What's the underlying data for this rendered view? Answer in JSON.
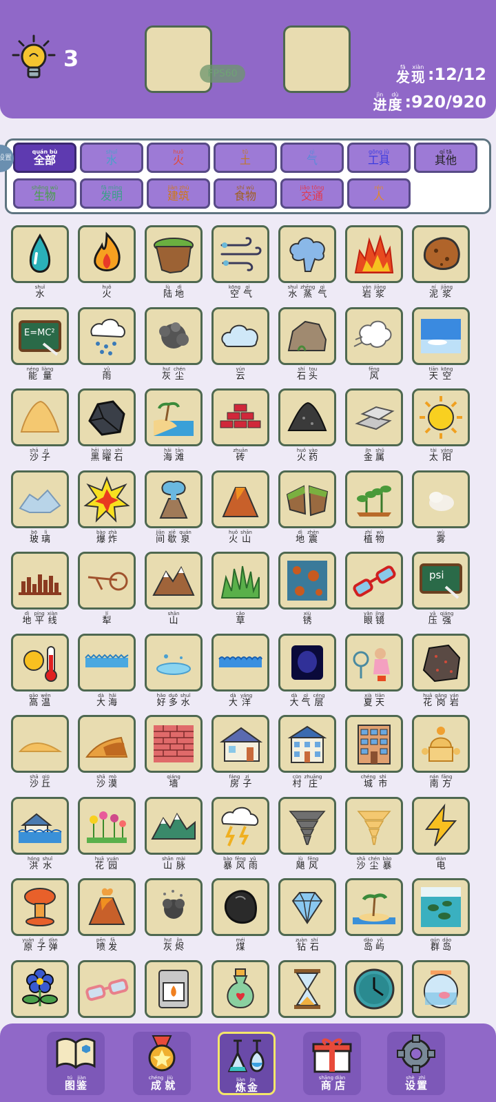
{
  "header": {
    "hint_count": "3",
    "fps": "FPS60",
    "discover": {
      "label": [
        {
          "py": "fā",
          "hz": "发"
        },
        {
          "py": "xiàn",
          "hz": "现"
        }
      ],
      "value": ":12/12"
    },
    "progress": {
      "label": [
        {
          "py": "jìn",
          "hz": "进"
        },
        {
          "py": "dù",
          "hz": "度"
        }
      ],
      "value": ":920/920"
    }
  },
  "side_tab": "设置",
  "categories": [
    {
      "py": "quán bù",
      "hz": "全部",
      "color": "#ffffff",
      "active": true
    },
    {
      "py": "shuǐ",
      "hz": "水",
      "color": "#4aa0c8"
    },
    {
      "py": "huǒ",
      "hz": "火",
      "color": "#e24a3a"
    },
    {
      "py": "tǔ",
      "hz": "土",
      "color": "#c07828"
    },
    {
      "py": "qì",
      "hz": "气",
      "color": "#5a8ad8"
    },
    {
      "py": "gōng jù",
      "hz": "工具",
      "color": "#3a3ae0"
    },
    {
      "py": "qí tā",
      "hz": "其他",
      "color": "#222222"
    },
    {
      "py": "shēng wù",
      "hz": "生物",
      "color": "#48a048"
    },
    {
      "py": "fā míng",
      "hz": "发明",
      "color": "#3aa088"
    },
    {
      "py": "jiàn zhù",
      "hz": "建筑",
      "color": "#d07818"
    },
    {
      "py": "shí wù",
      "hz": "食物",
      "color": "#a06020"
    },
    {
      "py": "jiāo tōng",
      "hz": "交通",
      "color": "#e03a50"
    },
    {
      "py": "rén",
      "hz": "人",
      "color": "#e0882a"
    }
  ],
  "elements": [
    {
      "icon": "water-drop",
      "name": [
        {
          "py": "shuǐ",
          "hz": "水"
        }
      ]
    },
    {
      "icon": "fire",
      "name": [
        {
          "py": "huǒ",
          "hz": "火"
        }
      ]
    },
    {
      "icon": "land",
      "name": [
        {
          "py": "lù",
          "hz": "陆"
        },
        {
          "py": "dì",
          "hz": "地"
        }
      ]
    },
    {
      "icon": "air",
      "name": [
        {
          "py": "kōng",
          "hz": "空"
        },
        {
          "py": "qì",
          "hz": "气"
        }
      ]
    },
    {
      "icon": "steam",
      "name": [
        {
          "py": "shuǐ",
          "hz": "水"
        },
        {
          "py": "zhēng",
          "hz": "蒸"
        },
        {
          "py": "qì",
          "hz": "气"
        }
      ]
    },
    {
      "icon": "lava",
      "name": [
        {
          "py": "yán",
          "hz": "岩"
        },
        {
          "py": "jiāng",
          "hz": "浆"
        }
      ]
    },
    {
      "icon": "mud",
      "name": [
        {
          "py": "ní",
          "hz": "泥"
        },
        {
          "py": "jiāng",
          "hz": "浆"
        }
      ]
    },
    {
      "icon": "energy",
      "name": [
        {
          "py": "néng",
          "hz": "能"
        },
        {
          "py": "liàng",
          "hz": "量"
        }
      ]
    },
    {
      "icon": "rain",
      "name": [
        {
          "py": "yǔ",
          "hz": "雨"
        }
      ]
    },
    {
      "icon": "dust",
      "name": [
        {
          "py": "huī",
          "hz": "灰"
        },
        {
          "py": "chén",
          "hz": "尘"
        }
      ]
    },
    {
      "icon": "cloud",
      "name": [
        {
          "py": "yún",
          "hz": "云"
        }
      ]
    },
    {
      "icon": "stone",
      "name": [
        {
          "py": "shí",
          "hz": "石"
        },
        {
          "py": "tou",
          "hz": "头"
        }
      ]
    },
    {
      "icon": "wind",
      "name": [
        {
          "py": "fēng",
          "hz": "风"
        }
      ]
    },
    {
      "icon": "sky",
      "name": [
        {
          "py": "tiān",
          "hz": "天"
        },
        {
          "py": "kōng",
          "hz": "空"
        }
      ]
    },
    {
      "icon": "sand",
      "name": [
        {
          "py": "shā",
          "hz": "沙"
        },
        {
          "py": "zi",
          "hz": "子"
        }
      ]
    },
    {
      "icon": "obsidian",
      "name": [
        {
          "py": "hēi",
          "hz": "黑"
        },
        {
          "py": "yào",
          "hz": "曜"
        },
        {
          "py": "shí",
          "hz": "石"
        }
      ]
    },
    {
      "icon": "beach",
      "name": [
        {
          "py": "hǎi",
          "hz": "海"
        },
        {
          "py": "tān",
          "hz": "滩"
        }
      ]
    },
    {
      "icon": "brick",
      "name": [
        {
          "py": "zhuān",
          "hz": "砖"
        }
      ]
    },
    {
      "icon": "gunpowder",
      "name": [
        {
          "py": "huǒ",
          "hz": "火"
        },
        {
          "py": "yào",
          "hz": "药"
        }
      ]
    },
    {
      "icon": "metal",
      "name": [
        {
          "py": "jīn",
          "hz": "金"
        },
        {
          "py": "shǔ",
          "hz": "属"
        }
      ]
    },
    {
      "icon": "sun",
      "name": [
        {
          "py": "tài",
          "hz": "太"
        },
        {
          "py": "yáng",
          "hz": "阳"
        }
      ]
    },
    {
      "icon": "glass",
      "name": [
        {
          "py": "bō",
          "hz": "玻"
        },
        {
          "py": "li",
          "hz": "璃"
        }
      ]
    },
    {
      "icon": "explosion",
      "name": [
        {
          "py": "bào",
          "hz": "爆"
        },
        {
          "py": "zhà",
          "hz": "炸"
        }
      ]
    },
    {
      "icon": "geyser",
      "name": [
        {
          "py": "jiān",
          "hz": "间"
        },
        {
          "py": "xiē",
          "hz": "歇"
        },
        {
          "py": "quán",
          "hz": "泉"
        }
      ]
    },
    {
      "icon": "volcano",
      "name": [
        {
          "py": "huǒ",
          "hz": "火"
        },
        {
          "py": "shān",
          "hz": "山"
        }
      ]
    },
    {
      "icon": "earthquake",
      "name": [
        {
          "py": "dì",
          "hz": "地"
        },
        {
          "py": "zhèn",
          "hz": "震"
        }
      ]
    },
    {
      "icon": "plant",
      "name": [
        {
          "py": "zhí",
          "hz": "植"
        },
        {
          "py": "wù",
          "hz": "物"
        }
      ]
    },
    {
      "icon": "fog",
      "name": [
        {
          "py": "wù",
          "hz": "雾"
        }
      ]
    },
    {
      "icon": "horizon",
      "name": [
        {
          "py": "dì",
          "hz": "地"
        },
        {
          "py": "píng",
          "hz": "平"
        },
        {
          "py": "xiàn",
          "hz": "线"
        }
      ]
    },
    {
      "icon": "plow",
      "name": [
        {
          "py": "lí",
          "hz": "犁"
        }
      ]
    },
    {
      "icon": "mountain",
      "name": [
        {
          "py": "shān",
          "hz": "山"
        }
      ]
    },
    {
      "icon": "grass",
      "name": [
        {
          "py": "cǎo",
          "hz": "草"
        }
      ]
    },
    {
      "icon": "rust",
      "name": [
        {
          "py": "xiù",
          "hz": "锈"
        }
      ]
    },
    {
      "icon": "glasses",
      "name": [
        {
          "py": "yǎn",
          "hz": "眼"
        },
        {
          "py": "jìng",
          "hz": "镜"
        }
      ]
    },
    {
      "icon": "pressure",
      "name": [
        {
          "py": "yā",
          "hz": "压"
        },
        {
          "py": "qiáng",
          "hz": "强"
        }
      ]
    },
    {
      "icon": "heat",
      "name": [
        {
          "py": "gāo",
          "hz": "高"
        },
        {
          "py": "wēn",
          "hz": "温"
        }
      ]
    },
    {
      "icon": "sea",
      "name": [
        {
          "py": "dà",
          "hz": "大"
        },
        {
          "py": "hǎi",
          "hz": "海"
        }
      ]
    },
    {
      "icon": "puddle",
      "name": [
        {
          "py": "hǎo",
          "hz": "好"
        },
        {
          "py": "duō",
          "hz": "多"
        },
        {
          "py": "shuǐ",
          "hz": "水"
        }
      ]
    },
    {
      "icon": "ocean",
      "name": [
        {
          "py": "dà",
          "hz": "大"
        },
        {
          "py": "yáng",
          "hz": "洋"
        }
      ]
    },
    {
      "icon": "atmosphere",
      "name": [
        {
          "py": "dà",
          "hz": "大"
        },
        {
          "py": "qì",
          "hz": "气"
        },
        {
          "py": "céng",
          "hz": "层"
        }
      ]
    },
    {
      "icon": "summer",
      "name": [
        {
          "py": "xià",
          "hz": "夏"
        },
        {
          "py": "tiān",
          "hz": "天"
        }
      ]
    },
    {
      "icon": "granite",
      "name": [
        {
          "py": "huā",
          "hz": "花"
        },
        {
          "py": "gǎng",
          "hz": "岗"
        },
        {
          "py": "yán",
          "hz": "岩"
        }
      ]
    },
    {
      "icon": "dune",
      "name": [
        {
          "py": "shā",
          "hz": "沙"
        },
        {
          "py": "qiū",
          "hz": "丘"
        }
      ]
    },
    {
      "icon": "desert",
      "name": [
        {
          "py": "shā",
          "hz": "沙"
        },
        {
          "py": "mò",
          "hz": "漠"
        }
      ]
    },
    {
      "icon": "wall",
      "name": [
        {
          "py": "qiáng",
          "hz": "墙"
        }
      ]
    },
    {
      "icon": "house",
      "name": [
        {
          "py": "fáng",
          "hz": "房"
        },
        {
          "py": "zi",
          "hz": "子"
        }
      ]
    },
    {
      "icon": "village",
      "name": [
        {
          "py": "cūn",
          "hz": "村"
        },
        {
          "py": "zhuāng",
          "hz": "庄"
        }
      ]
    },
    {
      "icon": "city",
      "name": [
        {
          "py": "chéng",
          "hz": "城"
        },
        {
          "py": "shì",
          "hz": "市"
        }
      ]
    },
    {
      "icon": "south",
      "name": [
        {
          "py": "nán",
          "hz": "南"
        },
        {
          "py": "fāng",
          "hz": "方"
        }
      ]
    },
    {
      "icon": "flood",
      "name": [
        {
          "py": "hóng",
          "hz": "洪"
        },
        {
          "py": "shuǐ",
          "hz": "水"
        }
      ]
    },
    {
      "icon": "garden",
      "name": [
        {
          "py": "huā",
          "hz": "花"
        },
        {
          "py": "yuán",
          "hz": "园"
        }
      ]
    },
    {
      "icon": "mountain-range",
      "name": [
        {
          "py": "shān",
          "hz": "山"
        },
        {
          "py": "mài",
          "hz": "脉"
        }
      ]
    },
    {
      "icon": "storm",
      "name": [
        {
          "py": "bào",
          "hz": "暴"
        },
        {
          "py": "fēng",
          "hz": "风"
        },
        {
          "py": "yǔ",
          "hz": "雨"
        }
      ]
    },
    {
      "icon": "tornado",
      "name": [
        {
          "py": "jù",
          "hz": "飓"
        },
        {
          "py": "fēng",
          "hz": "风"
        }
      ]
    },
    {
      "icon": "sandstorm",
      "name": [
        {
          "py": "shā",
          "hz": "沙"
        },
        {
          "py": "chén",
          "hz": "尘"
        },
        {
          "py": "bào",
          "hz": "暴"
        }
      ]
    },
    {
      "icon": "electricity",
      "name": [
        {
          "py": "diàn",
          "hz": "电"
        }
      ]
    },
    {
      "icon": "atomic-bomb",
      "name": [
        {
          "py": "yuán",
          "hz": "原"
        },
        {
          "py": "zǐ",
          "hz": "子"
        },
        {
          "py": "dàn",
          "hz": "弹"
        }
      ]
    },
    {
      "icon": "eruption",
      "name": [
        {
          "py": "pēn",
          "hz": "喷"
        },
        {
          "py": "fā",
          "hz": "发"
        }
      ]
    },
    {
      "icon": "ash",
      "name": [
        {
          "py": "huī",
          "hz": "灰"
        },
        {
          "py": "jìn",
          "hz": "烬"
        }
      ]
    },
    {
      "icon": "coal",
      "name": [
        {
          "py": "méi",
          "hz": "煤"
        }
      ]
    },
    {
      "icon": "diamond",
      "name": [
        {
          "py": "zuàn",
          "hz": "钻"
        },
        {
          "py": "shí",
          "hz": "石"
        }
      ]
    },
    {
      "icon": "island",
      "name": [
        {
          "py": "dǎo",
          "hz": "岛"
        },
        {
          "py": "yǔ",
          "hz": "屿"
        }
      ]
    },
    {
      "icon": "archipelago",
      "name": [
        {
          "py": "qún",
          "hz": "群"
        },
        {
          "py": "dǎo",
          "hz": "岛"
        }
      ]
    },
    {
      "icon": "flower",
      "name": []
    },
    {
      "icon": "sunglasses",
      "name": []
    },
    {
      "icon": "oven",
      "name": []
    },
    {
      "icon": "potion",
      "name": []
    },
    {
      "icon": "hourglass",
      "name": []
    },
    {
      "icon": "clock",
      "name": []
    },
    {
      "icon": "fishbowl",
      "name": []
    }
  ],
  "nav": [
    {
      "icon": "book-icon",
      "label": [
        {
          "py": "tú",
          "hz": "图"
        },
        {
          "py": "jiàn",
          "hz": "鉴"
        }
      ]
    },
    {
      "icon": "medal-icon",
      "label": [
        {
          "py": "chéng",
          "hz": "成"
        },
        {
          "py": "jiù",
          "hz": "就"
        }
      ]
    },
    {
      "icon": "flask-icon",
      "label": [
        {
          "py": "liàn",
          "hz": "炼"
        },
        {
          "py": "jīn",
          "hz": "金"
        }
      ],
      "active": true
    },
    {
      "icon": "gift-icon",
      "label": [
        {
          "py": "shāng",
          "hz": "商"
        },
        {
          "py": "diàn",
          "hz": "店"
        }
      ]
    },
    {
      "icon": "gear-icon",
      "label": [
        {
          "py": "shè",
          "hz": "设"
        },
        {
          "py": "zhì",
          "hz": "置"
        }
      ]
    }
  ]
}
